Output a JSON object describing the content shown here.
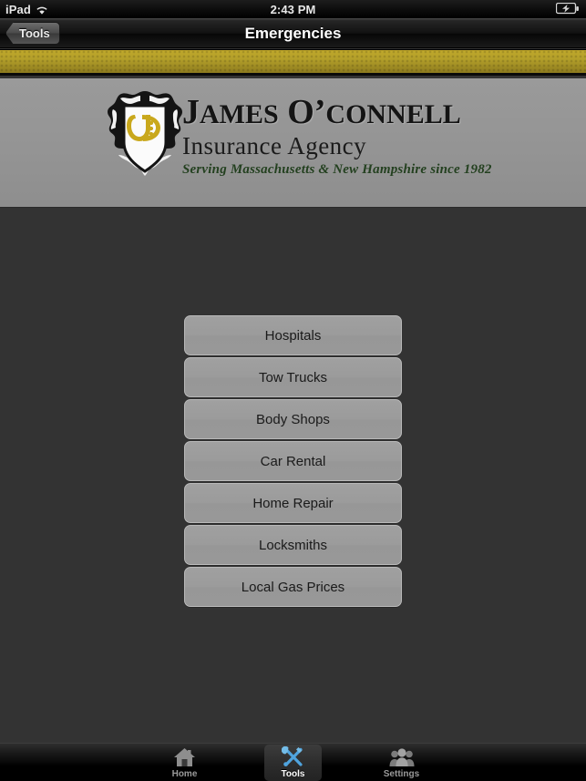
{
  "status_bar": {
    "carrier": "iPad",
    "wifi_icon": "wifi-icon",
    "time": "2:43 PM",
    "battery_icon": "battery-charging-icon"
  },
  "nav_bar": {
    "back_label": "Tools",
    "title": "Emergencies"
  },
  "brand": {
    "crest_icon": "company-crest-icon",
    "name_line1": "JAMES O'CONNELL",
    "name_line1_parts": {
      "j": "J",
      "ames": "AMES",
      "o": "O’",
      "connell": "CONNELL"
    },
    "name_line2": "Insurance Agency",
    "tagline": "Serving Massachusetts & New Hampshire since 1982",
    "gold_color": "#b39f2a",
    "tagline_color": "#23401f",
    "band_color": "#949494"
  },
  "menu": {
    "items": [
      {
        "label": "Hospitals"
      },
      {
        "label": "Tow Trucks"
      },
      {
        "label": "Body Shops"
      },
      {
        "label": "Car Rental"
      },
      {
        "label": "Home Repair"
      },
      {
        "label": "Locksmiths"
      },
      {
        "label": "Local Gas Prices"
      }
    ]
  },
  "tab_bar": {
    "accent_color": "#4fa3dd",
    "tabs": [
      {
        "label": "Home",
        "icon": "home-icon",
        "selected": false
      },
      {
        "label": "Tools",
        "icon": "tools-icon",
        "selected": true
      },
      {
        "label": "Settings",
        "icon": "people-icon",
        "selected": false
      }
    ]
  }
}
